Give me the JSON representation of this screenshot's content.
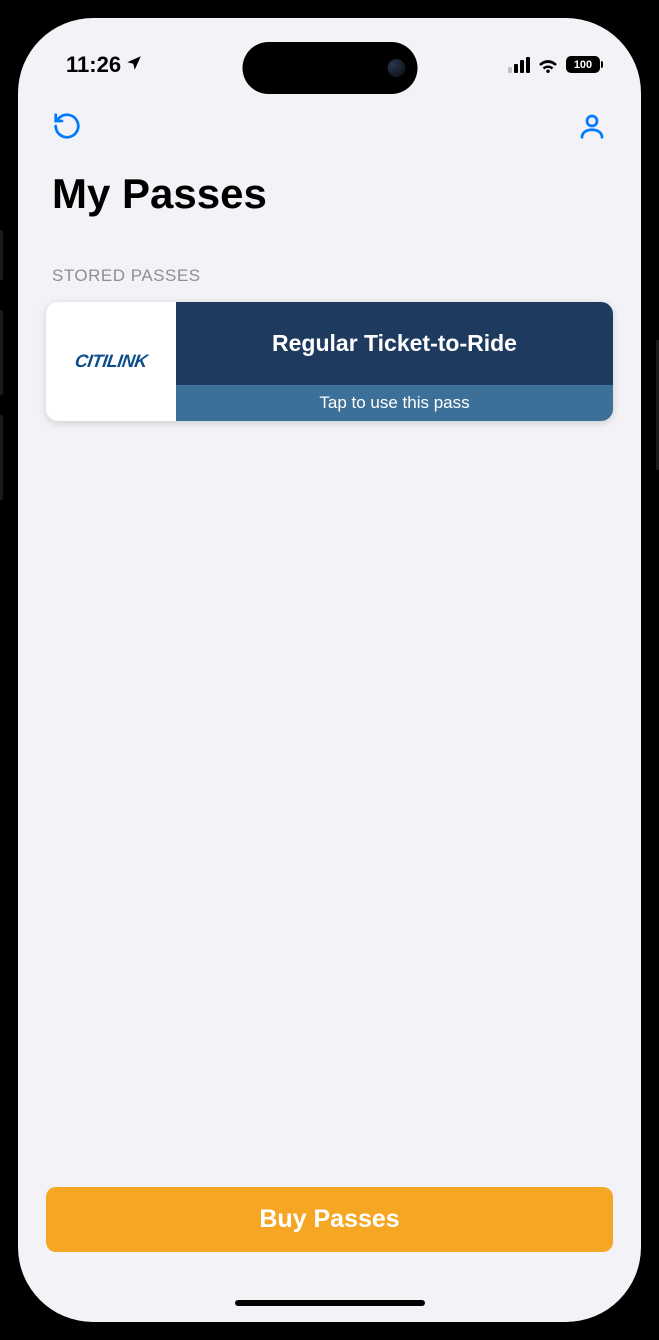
{
  "status_bar": {
    "time": "11:26",
    "battery_level": "100"
  },
  "nav": {
    "refresh_icon": "refresh",
    "profile_icon": "profile"
  },
  "header": {
    "title": "My Passes"
  },
  "section": {
    "label": "STORED PASSES"
  },
  "pass": {
    "provider_logo": "CITILINK",
    "title": "Regular Ticket-to-Ride",
    "hint": "Tap to use this pass"
  },
  "actions": {
    "buy_passes": "Buy Passes"
  }
}
